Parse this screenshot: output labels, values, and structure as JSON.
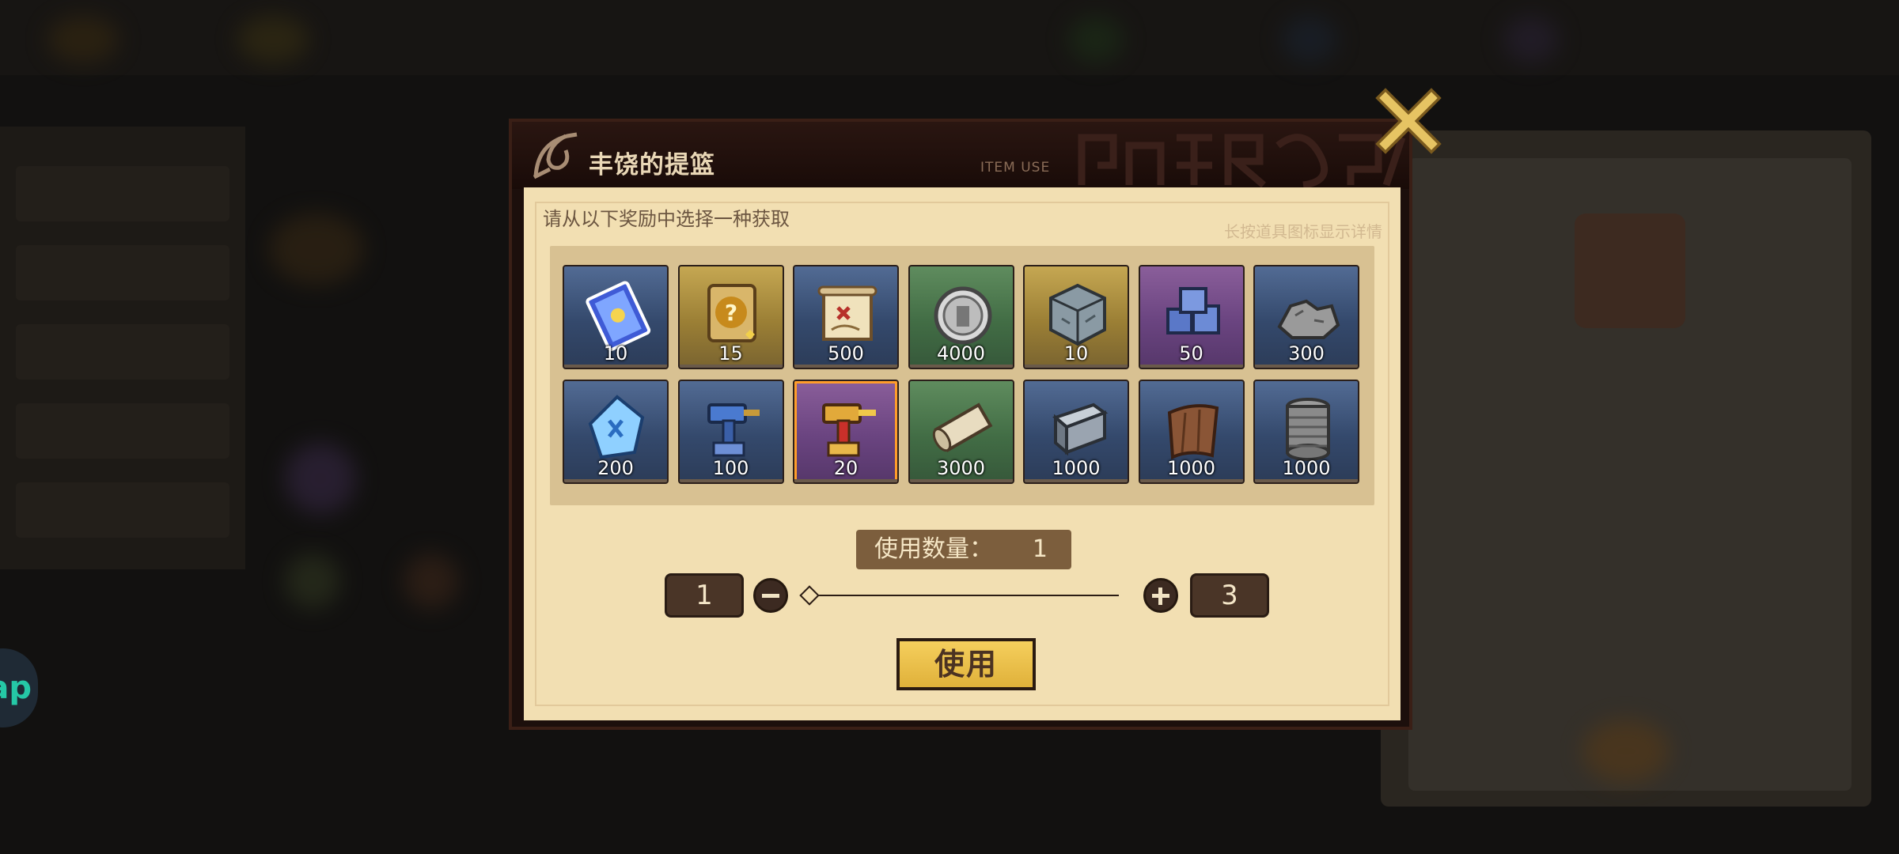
{
  "dialog": {
    "title": "丰饶的提篮",
    "subtitle": "ITEM USE",
    "instruction": "请从以下奖励中选择一种获取",
    "hint": "长按道具图标显示详情",
    "selected_index": 9
  },
  "items": [
    {
      "count": "10",
      "rarity": "blue",
      "icon": "ticket-icon"
    },
    {
      "count": "15",
      "rarity": "gold",
      "icon": "mystery-card-icon"
    },
    {
      "count": "500",
      "rarity": "blue",
      "icon": "treasure-map-scroll-icon"
    },
    {
      "count": "4000",
      "rarity": "green",
      "icon": "silver-coin-icon"
    },
    {
      "count": "10",
      "rarity": "gold",
      "icon": "stone-cube-icon"
    },
    {
      "count": "50",
      "rarity": "purple",
      "icon": "blue-ore-cubes-icon"
    },
    {
      "count": "300",
      "rarity": "blue",
      "icon": "ore-rocks-icon"
    },
    {
      "count": "200",
      "rarity": "blue",
      "icon": "blue-crystal-icon"
    },
    {
      "count": "100",
      "rarity": "blue",
      "icon": "blue-hammer-icon"
    },
    {
      "count": "20",
      "rarity": "purple",
      "icon": "gold-hammer-icon"
    },
    {
      "count": "3000",
      "rarity": "green",
      "icon": "parchment-roll-icon"
    },
    {
      "count": "1000",
      "rarity": "blue",
      "icon": "iron-ingot-icon"
    },
    {
      "count": "1000",
      "rarity": "blue",
      "icon": "leather-icon"
    },
    {
      "count": "1000",
      "rarity": "blue",
      "icon": "thread-spool-icon"
    }
  ],
  "quantity": {
    "label": "使用数量：",
    "value": "1",
    "min": "1",
    "max": "3",
    "slider_fraction": 0
  },
  "use_button": "使用",
  "help_button": "ap",
  "colors": {
    "selected_border": "#ff9d2a",
    "use_button": "#eec04c",
    "panel_bg": "#f2dfb2"
  }
}
